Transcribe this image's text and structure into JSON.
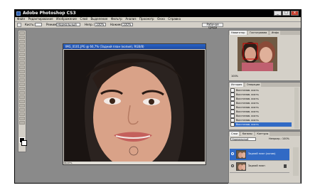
{
  "window": {
    "title": "Adobe Photoshop CS3",
    "controls": [
      "_",
      "□",
      "x"
    ]
  },
  "menu": [
    "Файл",
    "Редактирование",
    "Изображение",
    "Слой",
    "Выделение",
    "Фильтр",
    "Анализ",
    "Просмотр",
    "Окно",
    "Справка"
  ],
  "options": {
    "label1": "Кисть:",
    "label2": "Режим:",
    "mode_value": "Нормальный",
    "label3": "Непр.:",
    "opacity_value": "100%",
    "label4": "Нажим:",
    "flow_value": "100%",
    "workspace_button": "Рабочая среда"
  },
  "document": {
    "title": "IMG_0101.JPG @ 66,7% (Задний план (копия), RGB/8)",
    "status": "66,67%"
  },
  "navigator": {
    "tabs": [
      "Навигатор",
      "Гистограмма",
      "Инфо"
    ],
    "zoom": "100%"
  },
  "history": {
    "tabs": [
      "История",
      "Операции"
    ],
    "items": [
      "Восстанов. кисть",
      "Восстанов. кисть",
      "Восстанов. кисть",
      "Восстанов. кисть",
      "Восстанов. кисть",
      "Восстанов. кисть",
      "Восстанов. кисть",
      "Восстанов. кисть",
      "Восстанов. кисть"
    ]
  },
  "layers": {
    "tabs": [
      "Слои",
      "Каналы",
      "Контуры"
    ],
    "blend": "Нормальный",
    "opacity": "Непрозр.: 100%",
    "items": [
      {
        "name": "Задний план (копия)"
      },
      {
        "name": "Задний план"
      }
    ]
  },
  "colors": {
    "accent": "#316ac5",
    "workspace": "#8a8a8a",
    "titlebar": "#000000"
  }
}
